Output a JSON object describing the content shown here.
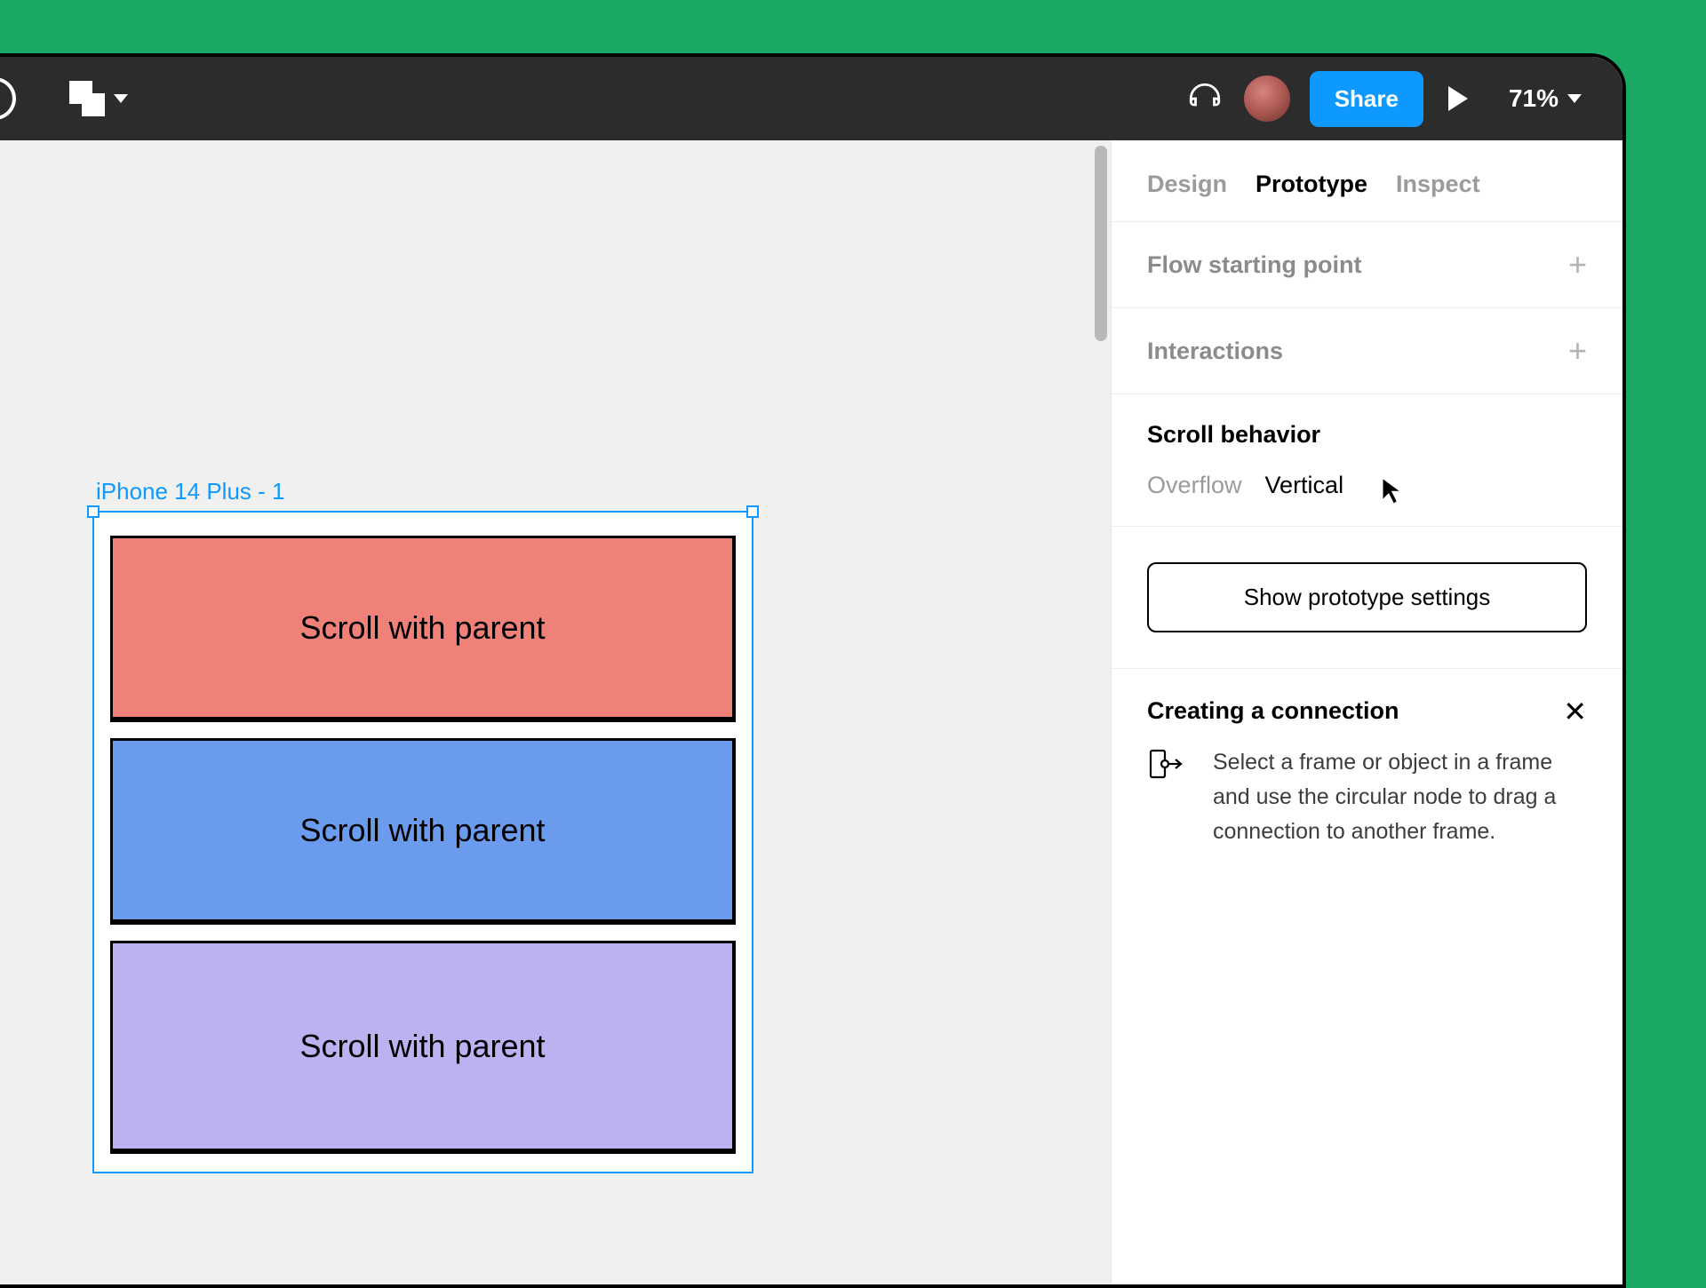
{
  "toolbar": {
    "share_label": "Share",
    "zoom": "71%"
  },
  "canvas": {
    "frame_label": "iPhone 14 Plus - 1",
    "cards": [
      {
        "label": "Scroll with parent"
      },
      {
        "label": "Scroll with parent"
      },
      {
        "label": "Scroll with parent"
      }
    ]
  },
  "panel": {
    "tabs": {
      "design": "Design",
      "prototype": "Prototype",
      "inspect": "Inspect"
    },
    "flow_section": "Flow starting point",
    "interactions_section": "Interactions",
    "scroll_section": "Scroll behavior",
    "overflow_label": "Overflow",
    "overflow_value": "Vertical",
    "prototype_settings_btn": "Show prototype settings",
    "hint_title": "Creating a connection",
    "hint_text": "Select a frame or object in a frame and use the circular node to drag a connection to another frame."
  }
}
